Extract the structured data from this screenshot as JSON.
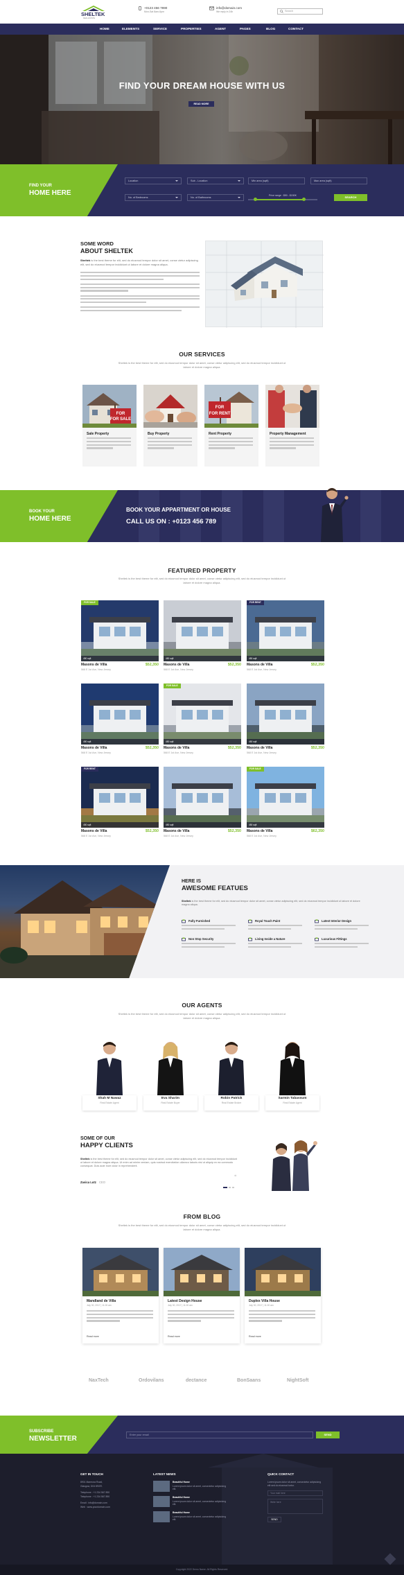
{
  "header": {
    "logo": "SHELTEK",
    "logo_tag": "REAL ESTATE",
    "phone": "+0123 456 7890",
    "phone_sub": "Mon-Sat 8am-6pm",
    "email": "info@domain.com",
    "email_sub": "We reply in 24h",
    "search_placeholder": "Search"
  },
  "nav": [
    "HOME",
    "ELEMENTS",
    "SERVICE",
    "PROPERTIES",
    "AGENT",
    "PAGES",
    "BLOG",
    "CONTACT"
  ],
  "hero": {
    "title": "FIND YOUR DREAM HOUSE WITH US",
    "button": "READ MORE"
  },
  "search": {
    "label_small": "FIND YOUR",
    "label_big": "HOME HERE",
    "location": "Location",
    "sub_location": "Sub - Location",
    "min_area": "Min area (sqft)",
    "max_area": "Max area (sqft)",
    "bedrooms": "No. of Bedrooms",
    "bathrooms": "No. of Bathrooms",
    "price_range": "Price range : $50 - $150K",
    "button": "SEARCH"
  },
  "about": {
    "title_small": "SOME WORD",
    "title_big": "ABOUT SHELTEK",
    "brand": "Sheltek",
    "text": "is the best theme for elit, sed do eiusmod tempor dolor sit amet, conse ctetur adipiscing elit, sed do eiusmod tempor incididunt ut labore et dolore magna aliqua."
  },
  "services": {
    "title": "OUR SERVICES",
    "subtitle": "Sheltek is the best theme for elit, sed do eiusmod tempor dolor sit amet, conse ctetur adipiscing elit, sed do eiusmod tempor incididunt ut labore et dolore magna aliqua.",
    "items": [
      {
        "title": "Sale Property",
        "sign": "FOR SALE"
      },
      {
        "title": "Buy Property",
        "sign": ""
      },
      {
        "title": "Rent Property",
        "sign": "FOR RENT"
      },
      {
        "title": "Property Management",
        "sign": ""
      }
    ]
  },
  "booking": {
    "label_small": "BOOK YOUR",
    "label_big": "HOME HERE",
    "headline": "BOOK YOUR APPARTMENT OR HOUSE",
    "call": "CALL US ON : +0123 456 789"
  },
  "featured": {
    "title": "FEATURED PROPERTY",
    "subtitle": "Sheltek is the best theme for elit, sed do eiusmod tempor dolor sit amet, conse ctetur adipiscing elit, sed do eiusmod tempor incididunt ut labore et dolore magna aliqua.",
    "items": [
      {
        "name": "Masons de Villa",
        "price": "$52,350",
        "address": "568 E 1st Ave, New Jersey",
        "tag": "FOR SALE",
        "tagcolor": "#7fbf2a",
        "sqft": "450 sqft",
        "c1": "#243a6b",
        "c2": "#7a8aa4"
      },
      {
        "name": "Masons de Villa",
        "price": "$52,350",
        "address": "568 E 1st Ave, New Jersey",
        "tag": "",
        "tagcolor": "",
        "sqft": "450 sqft",
        "c1": "#c9cdd4",
        "c2": "#8e939b"
      },
      {
        "name": "Masons de Villa",
        "price": "$52,350",
        "address": "568 E 1st Ave, New Jersey",
        "tag": "FOR RENT",
        "tagcolor": "#2b2d5c",
        "sqft": "450 sqft",
        "c1": "#4b6a93",
        "c2": "#6b7c86"
      },
      {
        "name": "Masons de Villa",
        "price": "$52,350",
        "address": "568 E 1st Ave, New Jersey",
        "tag": "",
        "tagcolor": "",
        "sqft": "450 sqft",
        "c1": "#1f3a70",
        "c2": "#667a93"
      },
      {
        "name": "Masons de Villa",
        "price": "$52,350",
        "address": "568 E 1st Ave, New Jersey",
        "tag": "FOR SALE",
        "tagcolor": "#7fbf2a",
        "sqft": "450 sqft",
        "c1": "#e4e6ea",
        "c2": "#9da3ac"
      },
      {
        "name": "Masons de Villa",
        "price": "$52,350",
        "address": "568 E 1st Ave, New Jersey",
        "tag": "",
        "tagcolor": "",
        "sqft": "450 sqft",
        "c1": "#8aa4c3",
        "c2": "#4e5e6c"
      },
      {
        "name": "Masons de Villa",
        "price": "$52,350",
        "address": "568 E 1st Ave, New Jersey",
        "tag": "FOR RENT",
        "tagcolor": "#2b2d5c",
        "sqft": "450 sqft",
        "c1": "#1b2b50",
        "c2": "#a37945"
      },
      {
        "name": "Masons de Villa",
        "price": "$52,350",
        "address": "568 E 1st Ave, New Jersey",
        "tag": "",
        "tagcolor": "",
        "sqft": "450 sqft",
        "c1": "#a7bdd8",
        "c2": "#55606d"
      },
      {
        "name": "Masons de Villa",
        "price": "$62,350",
        "address": "568 E 1st Ave, New Jersey",
        "tag": "FOR SALE",
        "tagcolor": "#7fbf2a",
        "sqft": "450 sqft",
        "c1": "#7fb3e0",
        "c2": "#9aa5ae"
      }
    ]
  },
  "features": {
    "title_small": "HERE IS",
    "title_big": "AWESOME FEATUES",
    "brand": "Sheltek",
    "intro": "is the best theme for elit, sed do eiusmod tempor dolor sit amet, conse ctetur adipiscing elit, sed do eiusmod tempor incididunt ut labore et dolore magna aliqua.",
    "items": [
      "Fully Furnished",
      "Royal Touch Paint",
      "Latest Interior Design",
      "Non Stop Security",
      "Living Inside a Nature",
      "Luxurious Fittings"
    ]
  },
  "agents": {
    "title": "OUR AGENTS",
    "subtitle": "Sheltek is the best theme for elit, sed do eiusmod tempor dolor sit amet, conse ctetur adipiscing elit, sed do eiusmod tempor incididunt ut labore et dolore magna aliqua.",
    "items": [
      {
        "name": "Shah M Nawaz",
        "role": "Real Estate Agent"
      },
      {
        "name": "Eva Sharim",
        "role": "Real Estate Buyer"
      },
      {
        "name": "Robin Patrick",
        "role": "Real Estate Broker"
      },
      {
        "name": "Sarmin Tabassum",
        "role": "Real Estate Agent"
      }
    ]
  },
  "clients": {
    "title_small": "SOME OF OUR",
    "title_big": "HAPPY CLIENTS",
    "brand": "Sheltek",
    "text": "is the best theme for elit, sed do eiusmod tempor dolor sit amet, conse ctetur adipiscing elit, sed do eiusmod tempor incididunt ut labore et dolore magna aliqua. Ut enim ad minim veniam, quis nostrud exercitation ullamco laboris nisi ut aliquip ex ea commodo consequat. Duis aute irure dolor in reprehenderit.",
    "author": "Zasica Lutz",
    "author_role": "CEO"
  },
  "blog": {
    "title": "FROM BLOG",
    "subtitle": "Sheltek is the best theme for elit, sed do eiusmod tempor dolor sit amet, conse ctetur adipiscing elit, sed do eiusmod tempor incididunt ut labore et dolore magna aliqua.",
    "items": [
      {
        "title": "Mandland de Villa",
        "date": "July 30, 2017 | 11:00 am",
        "more": "Read more",
        "c1": "#3e4f6a",
        "c2": "#b18a58"
      },
      {
        "title": "Latest Design House",
        "date": "July 30, 2017 | 11:00 am",
        "more": "Read more",
        "c1": "#8fa9c8",
        "c2": "#6e5b47"
      },
      {
        "title": "Duplex Villa House",
        "date": "July 30, 2017 | 11:00 am",
        "more": "Read more",
        "c1": "#2e3f5e",
        "c2": "#9c7a4a"
      }
    ]
  },
  "partners": [
    "NaxTech",
    "Ordovilans",
    "dectance",
    "BonSaans",
    "NightSoft"
  ],
  "newsletter": {
    "label_small": "SUBSCRIBE",
    "label_big": "NEWSLETTER",
    "placeholder": "Enter your email",
    "button": "SEND"
  },
  "footer": {
    "contact_title": "GET IN TOUCH",
    "contact_lines": [
      "8901 Marmora Road,",
      "Glasgow, D04 89GR.",
      "Telephone : +1 234 567 890",
      "Telephone : +1 234 567 890",
      "Email : info@domain.com",
      "Web : www.yourdomain.com"
    ],
    "news_title": "LATEST NEWS",
    "news": [
      {
        "title": "Beautiful Home",
        "text": "Lorem ipsum dolor sit amet, consectetur adipisicing elit."
      },
      {
        "title": "Beautiful Home",
        "text": "Lorem ipsum dolor sit amet, consectetur adipisicing elit."
      },
      {
        "title": "Beautiful Home",
        "text": "Lorem ipsum dolor sit amet, consectetur adipisicing elit."
      }
    ],
    "quick_title": "QUICK CONTACT",
    "quick_text": "Lorem ipsum dolor sit amet, consectetur adipisicing elit sed do eiusmod tortor.",
    "name_ph": "Your mail here",
    "msg_ph": "Write here",
    "send": "SEND",
    "copyright": "Copyright 2022 Demo Name. All Rights Reserved."
  },
  "colors": {
    "brand_navy": "#2b2d5c",
    "accent_green": "#7fbf2a",
    "footer": "#1d1e2c"
  }
}
